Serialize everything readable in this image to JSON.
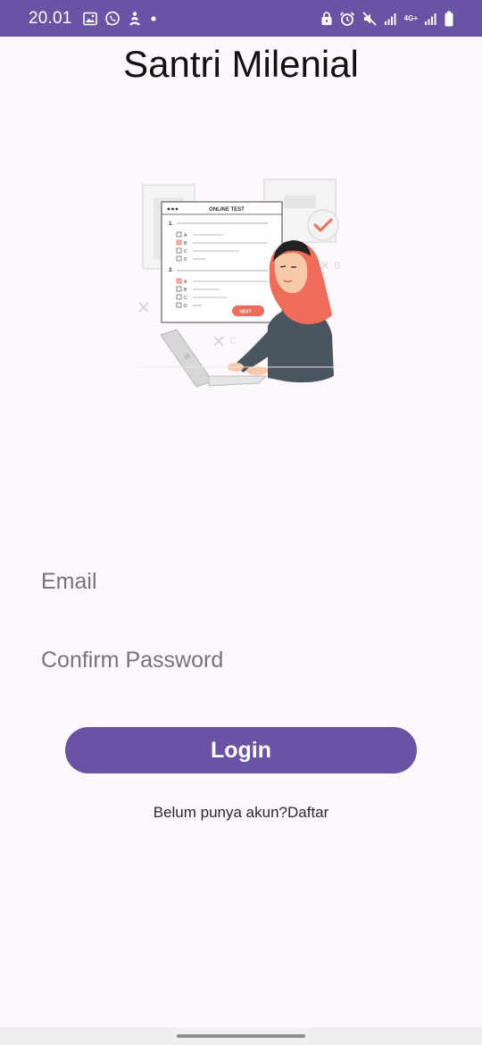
{
  "status_bar": {
    "time": "20.01",
    "network_label": "4G+",
    "icons_left": [
      "gallery-icon",
      "whatsapp-icon",
      "notification-icon",
      "dot-icon"
    ],
    "icons_right": [
      "lock-icon",
      "alarm-icon",
      "mute-icon",
      "signal-icon",
      "network-4g-icon",
      "signal-icon",
      "battery-icon"
    ]
  },
  "app": {
    "title": "Santri Milenial"
  },
  "illustration": {
    "header": "ONLINE TEST",
    "q1": "1.",
    "q2": "2.",
    "opt_a": "A",
    "opt_b": "B",
    "opt_c": "C",
    "opt_d": "D",
    "next_label": "NEXT",
    "deco_b": "B",
    "deco_c": "C"
  },
  "form": {
    "email_placeholder": "Email",
    "password_placeholder": "Confirm Password",
    "login_label": "Login",
    "register_text": "Belum punya akun?Daftar"
  },
  "colors": {
    "primary": "#6A52A4",
    "background": "#FEF7FD",
    "accent": "#EE6C5A"
  }
}
